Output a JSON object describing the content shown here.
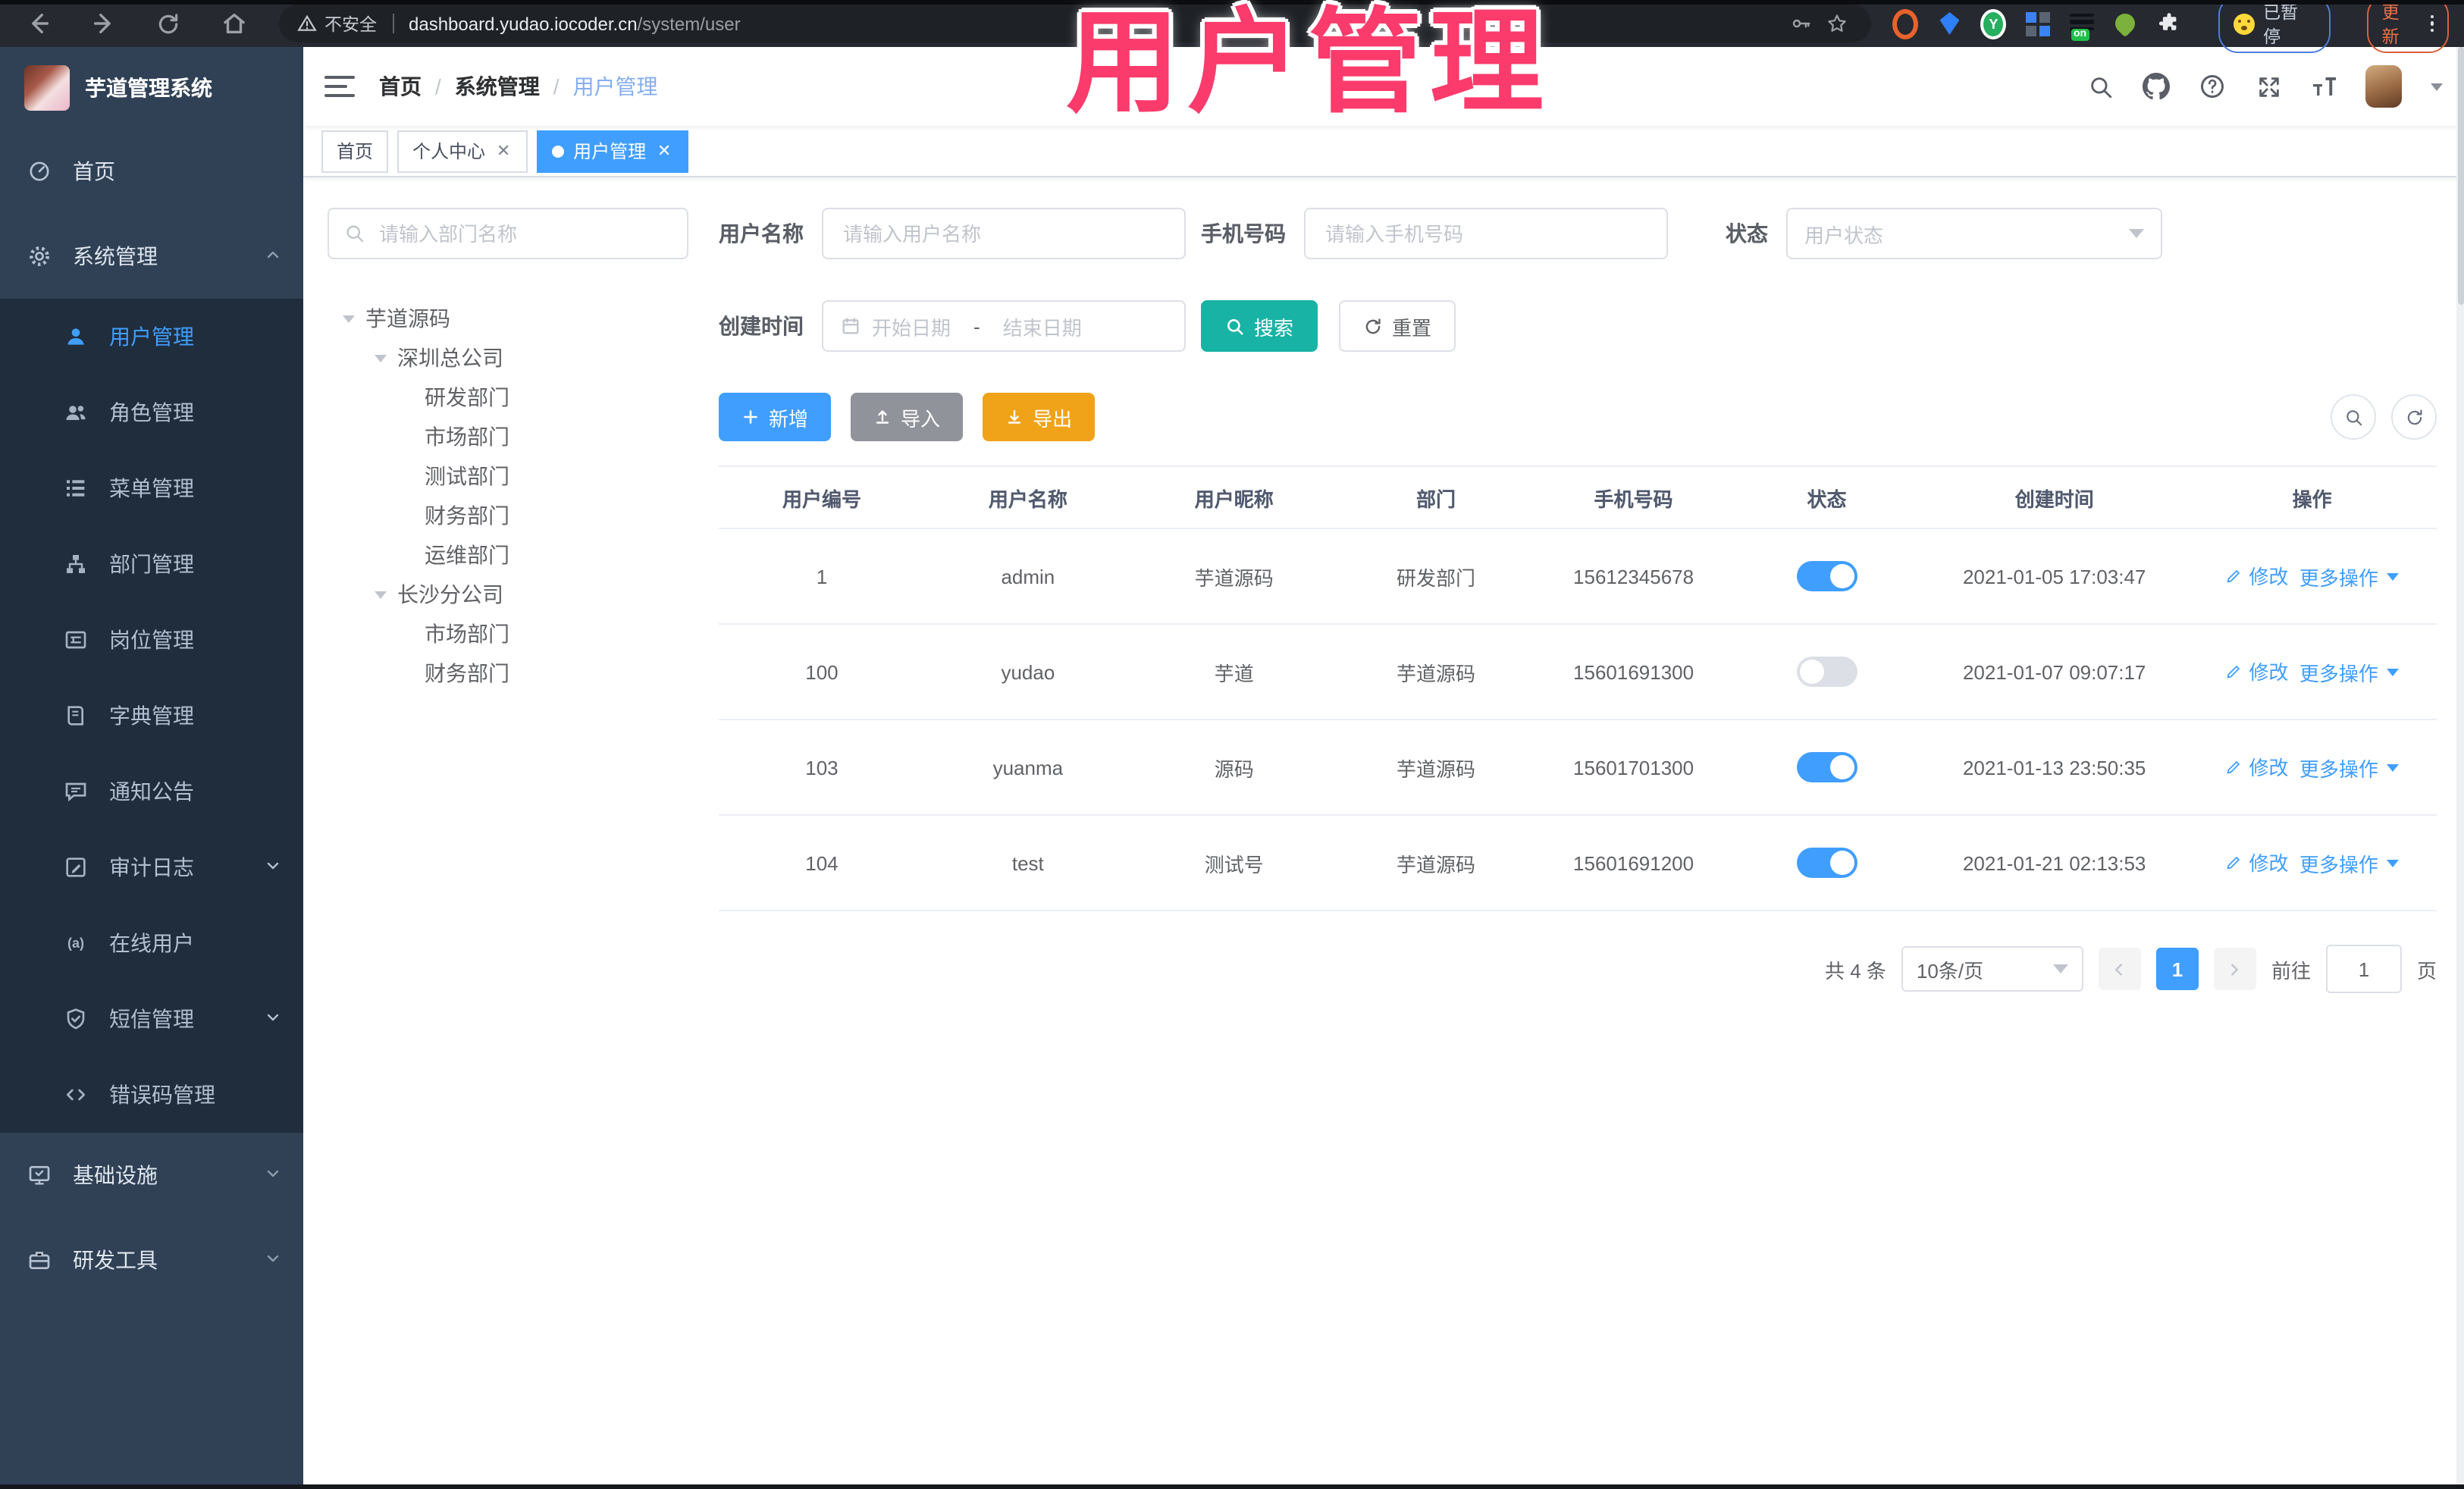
{
  "browser": {
    "security_label": "不安全",
    "url_host": "dashboard.yudao.iocoder.cn",
    "url_path": "/system/user",
    "extension_badge_on": "on",
    "profile_badge": "已暂停",
    "update_label": "更新"
  },
  "overlay": {
    "title": "用户管理",
    "color": "#FB3B6B"
  },
  "sidebar": {
    "logo_title": "芋道管理系统",
    "items": [
      {
        "label": "首页",
        "icon": "dashboard-icon"
      },
      {
        "label": "系统管理",
        "icon": "gear-icon"
      },
      {
        "label": "用户管理",
        "icon": "user-icon"
      },
      {
        "label": "角色管理",
        "icon": "users-icon"
      },
      {
        "label": "菜单管理",
        "icon": "menu-list-icon"
      },
      {
        "label": "部门管理",
        "icon": "org-tree-icon"
      },
      {
        "label": "岗位管理",
        "icon": "id-card-icon"
      },
      {
        "label": "字典管理",
        "icon": "dictionary-icon"
      },
      {
        "label": "通知公告",
        "icon": "announcement-icon"
      },
      {
        "label": "审计日志",
        "icon": "audit-log-icon"
      },
      {
        "label": "在线用户",
        "icon": "online-user-icon"
      },
      {
        "label": "短信管理",
        "icon": "sms-shield-icon"
      },
      {
        "label": "错误码管理",
        "icon": "error-code-icon"
      },
      {
        "label": "基础设施",
        "icon": "infrastructure-icon"
      },
      {
        "label": "研发工具",
        "icon": "devtools-icon"
      }
    ]
  },
  "header": {
    "breadcrumb": [
      "首页",
      "系统管理",
      "用户管理"
    ],
    "breadcrumb_separator": "/",
    "tabs": [
      {
        "label": "首页"
      },
      {
        "label": "个人中心"
      },
      {
        "label": "用户管理"
      }
    ]
  },
  "tree": {
    "search_placeholder": "请输入部门名称",
    "nodes": [
      {
        "label": "芋道源码"
      },
      {
        "label": "深圳总公司"
      },
      {
        "label": "研发部门"
      },
      {
        "label": "市场部门"
      },
      {
        "label": "测试部门"
      },
      {
        "label": "财务部门"
      },
      {
        "label": "运维部门"
      },
      {
        "label": "长沙分公司"
      },
      {
        "label": "市场部门"
      },
      {
        "label": "财务部门"
      }
    ]
  },
  "filters": {
    "username_label": "用户名称",
    "username_placeholder": "请输入用户名称",
    "mobile_label": "手机号码",
    "mobile_placeholder": "请输入手机号码",
    "status_label": "状态",
    "status_placeholder": "用户状态",
    "create_time_label": "创建时间",
    "date_start_placeholder": "开始日期",
    "date_separator": "-",
    "date_end_placeholder": "结束日期",
    "search_button": "搜索",
    "reset_button": "重置"
  },
  "toolbar": {
    "add": "新增",
    "import": "导入",
    "export": "导出"
  },
  "table": {
    "columns": [
      "用户编号",
      "用户名称",
      "用户昵称",
      "部门",
      "手机号码",
      "状态",
      "创建时间",
      "操作"
    ],
    "edit_label": "修改",
    "more_label": "更多操作",
    "rows": [
      {
        "id": "1",
        "username": "admin",
        "nickname": "芋道源码",
        "dept": "研发部门",
        "mobile": "15612345678",
        "status": true,
        "created": "2021-01-05 17:03:47"
      },
      {
        "id": "100",
        "username": "yudao",
        "nickname": "芋道",
        "dept": "芋道源码",
        "mobile": "15601691300",
        "status": false,
        "created": "2021-01-07 09:07:17"
      },
      {
        "id": "103",
        "username": "yuanma",
        "nickname": "源码",
        "dept": "芋道源码",
        "mobile": "15601701300",
        "status": true,
        "created": "2021-01-13 23:50:35"
      },
      {
        "id": "104",
        "username": "test",
        "nickname": "测试号",
        "dept": "芋道源码",
        "mobile": "15601691200",
        "status": true,
        "created": "2021-01-21 02:13:53"
      }
    ]
  },
  "pagination": {
    "total": "共 4 条",
    "page_size": "10条/页",
    "page": "1",
    "goto_label": "前往",
    "goto_value": "1",
    "unit_label": "页"
  },
  "colors": {
    "accent": "#409EFF",
    "search_button": "#18B3A4",
    "export_button": "#F0A318",
    "import_button": "#909399",
    "overlay_text": "#FB3B6B",
    "sidebar_bg": "#304156",
    "submenu_bg": "#1F2D3D"
  }
}
